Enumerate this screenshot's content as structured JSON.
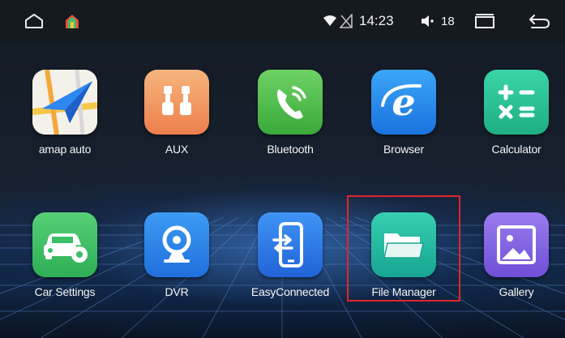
{
  "status_bar": {
    "time": "14:23",
    "volume": "18",
    "icons": [
      "home-icon",
      "app-store-icon",
      "wifi-icon",
      "no-sim-icon",
      "volume-icon",
      "recent-apps-icon",
      "back-icon"
    ]
  },
  "apps": [
    {
      "label": "amap auto",
      "icon": "amap-icon",
      "color": "#2f7de1"
    },
    {
      "label": "AUX",
      "icon": "aux-cable-icon",
      "color": "#f19562"
    },
    {
      "label": "Bluetooth",
      "icon": "bluetooth-phone-icon",
      "color": "#4fbf4a"
    },
    {
      "label": "Browser",
      "icon": "browser-icon",
      "color": "#1d8ff2"
    },
    {
      "label": "Calculator",
      "icon": "calculator-icon",
      "color": "#2bc39a"
    },
    {
      "label": "Car Settings",
      "icon": "car-settings-icon",
      "color": "#3dbf68"
    },
    {
      "label": "DVR",
      "icon": "dvr-camera-icon",
      "color": "#2f86ea"
    },
    {
      "label": "EasyConnected",
      "icon": "easyconnected-icon",
      "color": "#2f7fe8"
    },
    {
      "label": "File Manager",
      "icon": "folder-icon",
      "color": "#27b8a6"
    },
    {
      "label": "Gallery",
      "icon": "gallery-icon",
      "color": "#7d5fe0"
    }
  ],
  "highlight_color": "#e0262b"
}
